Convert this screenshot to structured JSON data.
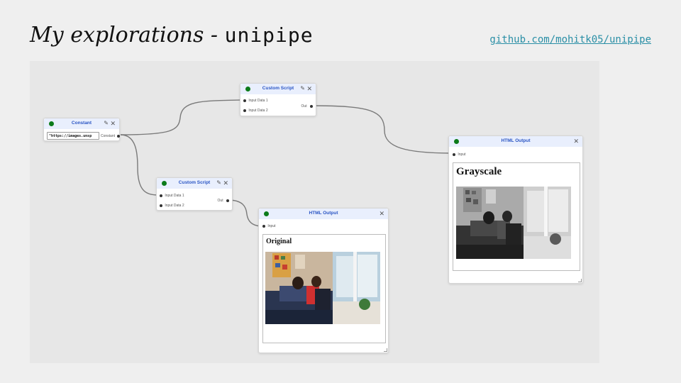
{
  "slide": {
    "title_italic": "My explorations - ",
    "title_mono": "unipipe",
    "repo_link": "github.com/mohitk05/unipipe"
  },
  "nodes": {
    "constant": {
      "title": "Constant",
      "value": "\"https://images.unsp",
      "output_label": "Constant"
    },
    "script_top": {
      "title": "Custom Script",
      "input1": "Input Data 1",
      "input2": "Input Data 2",
      "output_label": "Out"
    },
    "script_bottom": {
      "title": "Custom Script",
      "input1": "Input Data 1",
      "input2": "Input Data 2",
      "output_label": "Out"
    },
    "html_original": {
      "title": "HTML Output",
      "input_label": "Input",
      "heading": "Original"
    },
    "html_grayscale": {
      "title": "HTML Output",
      "input_label": "Input",
      "heading": "Grayscale"
    }
  },
  "icons": {
    "edit": "pencil-icon",
    "close": "close-icon",
    "status": "green-status-dot"
  },
  "colors": {
    "header_bg": "#e9effd",
    "header_title": "#2a55c4",
    "status_dot": "#0c7b1a",
    "link": "#2a8fa6"
  }
}
